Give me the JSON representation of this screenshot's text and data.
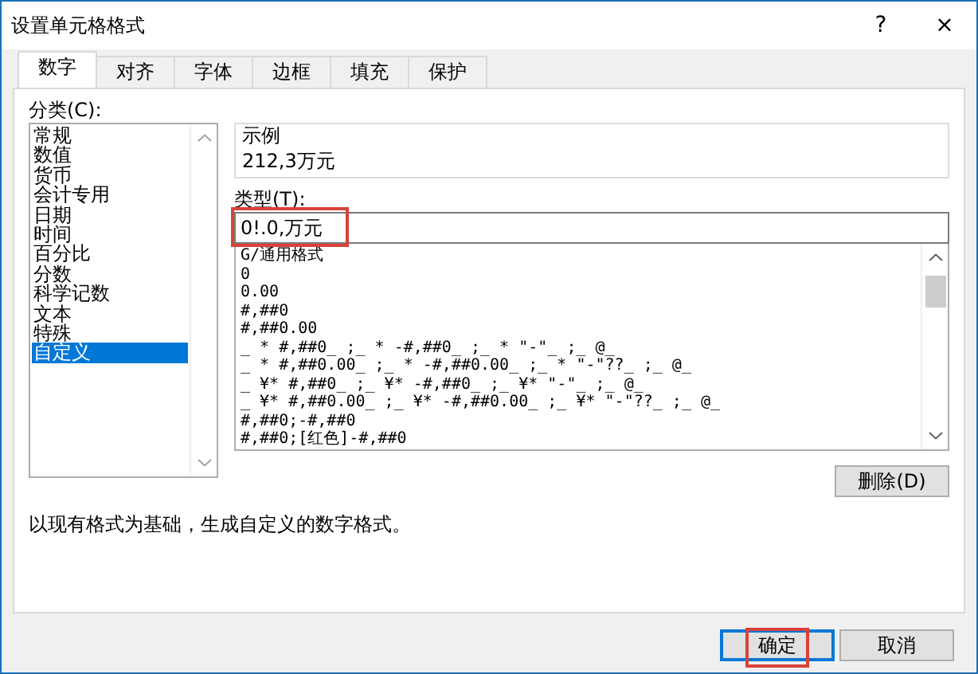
{
  "window": {
    "title": "设置单元格格式",
    "help": "?",
    "close": "×"
  },
  "tabs": [
    {
      "label": "数字",
      "selected": true
    },
    {
      "label": "对齐",
      "selected": false
    },
    {
      "label": "字体",
      "selected": false
    },
    {
      "label": "边框",
      "selected": false
    },
    {
      "label": "填充",
      "selected": false
    },
    {
      "label": "保护",
      "selected": false
    }
  ],
  "category": {
    "label": "分类(C):",
    "items": [
      {
        "label": "常规",
        "selected": false
      },
      {
        "label": "数值",
        "selected": false
      },
      {
        "label": "货币",
        "selected": false
      },
      {
        "label": "会计专用",
        "selected": false
      },
      {
        "label": "日期",
        "selected": false
      },
      {
        "label": "时间",
        "selected": false
      },
      {
        "label": "百分比",
        "selected": false
      },
      {
        "label": "分数",
        "selected": false
      },
      {
        "label": "科学记数",
        "selected": false
      },
      {
        "label": "文本",
        "selected": false
      },
      {
        "label": "特殊",
        "selected": false
      },
      {
        "label": "自定义",
        "selected": true
      }
    ]
  },
  "sample": {
    "label": "示例",
    "value": "212,3万元"
  },
  "type": {
    "label": "类型(T):",
    "value": "0!.0,万元",
    "highlighted": true
  },
  "formats": [
    "G/通用格式",
    "0",
    "0.00",
    "#,##0",
    "#,##0.00",
    "_ * #,##0_ ;_ * -#,##0_ ;_ * \"-\"_ ;_ @_",
    "_ * #,##0.00_ ;_ * -#,##0.00_ ;_ * \"-\"??_ ;_ @_",
    "_ ¥* #,##0_ ;_ ¥* -#,##0_ ;_ ¥* \"-\"_ ;_ @_",
    "_ ¥* #,##0.00_ ;_ ¥* -#,##0.00_ ;_ ¥* \"-\"??_ ;_ @_",
    "#,##0;-#,##0",
    "#,##0;[红色]-#,##0"
  ],
  "delete_button": "删除(D)",
  "description": "以现有格式为基础，生成自定义的数字格式。",
  "buttons": [
    {
      "label": "确定",
      "highlighted": true
    },
    {
      "label": "取消",
      "highlighted": false
    }
  ]
}
